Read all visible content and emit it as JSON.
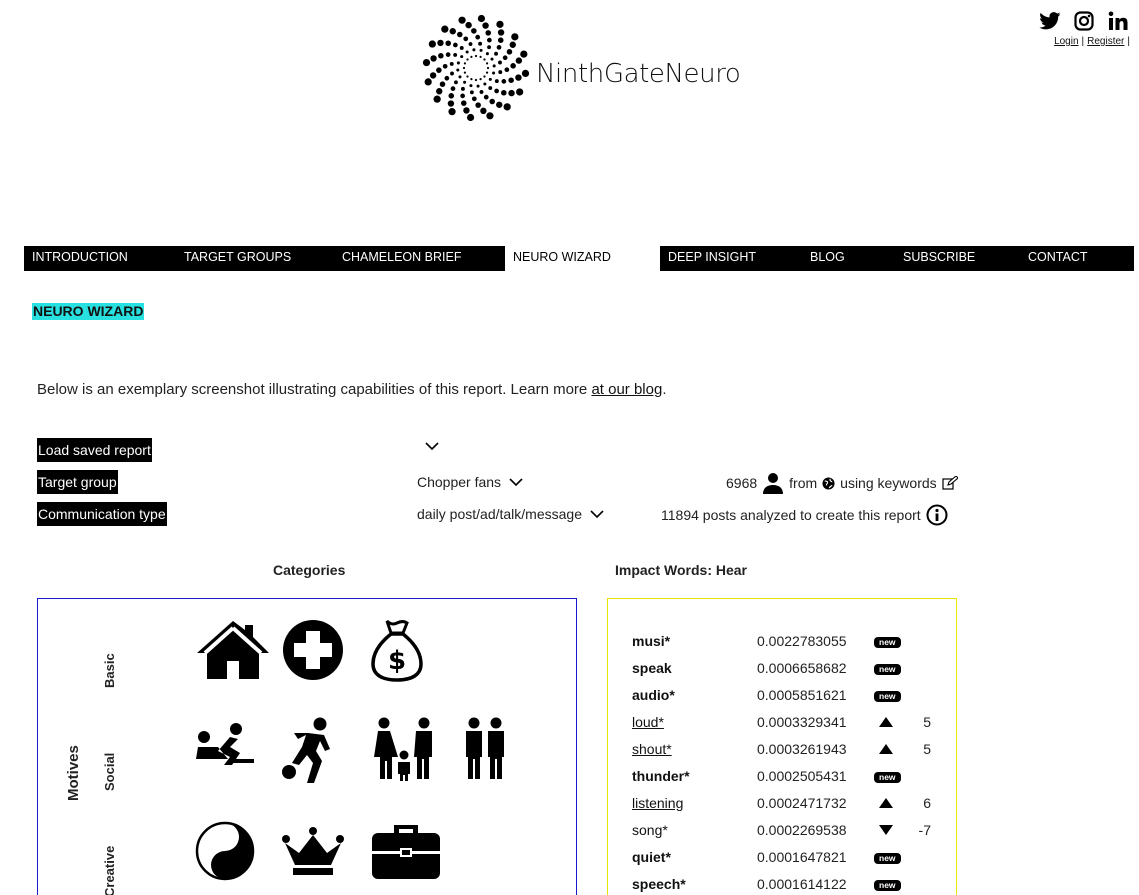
{
  "brand": {
    "name": "NinthGateNeuro",
    "logo_icon": "spiral-dots-logo"
  },
  "social": {
    "icons": [
      "twitter-icon",
      "instagram-icon",
      "linkedin-icon"
    ]
  },
  "auth": {
    "login": "Login",
    "sep": "|",
    "register": "Register"
  },
  "nav": {
    "items": [
      {
        "label": "INTRODUCTION"
      },
      {
        "label": "TARGET GROUPS"
      },
      {
        "label": "CHAMELEON BRIEF"
      },
      {
        "label": "NEURO WIZARD",
        "active": true
      },
      {
        "label": "DEEP INSIGHT"
      },
      {
        "label": "BLOG"
      },
      {
        "label": "SUBSCRIBE"
      },
      {
        "label": "CONTACT"
      }
    ]
  },
  "page": {
    "heading": "NEURO WIZARD",
    "intro_text": "Below is an exemplary screenshot illustrating capabilities of this report. Learn more ",
    "intro_link": "at our blog",
    "intro_end": "."
  },
  "controls": {
    "load_label": "Load saved report",
    "load_value": "",
    "target_label": "Target group",
    "target_value": "Chopper fans",
    "target_count": "6968",
    "target_from": "from",
    "target_using": "using keywords",
    "comm_label": "Communication type",
    "comm_value": "daily post/ad/talk/message",
    "comm_info": "11894 posts analyzed to create this report"
  },
  "categories": {
    "title": "Categories",
    "group": "Motives",
    "rows": [
      {
        "label": "Basic",
        "icons": [
          "home-icon",
          "health-cross-icon",
          "money-bag-icon"
        ]
      },
      {
        "label": "Social",
        "icons": [
          "intimacy-icon",
          "soccer-player-icon",
          "family-icon",
          "couple-icon"
        ]
      },
      {
        "label": "Creative",
        "icons": [
          "yin-yang-icon",
          "crown-icon",
          "briefcase-icon"
        ]
      }
    ]
  },
  "impact": {
    "title": "Impact Words: Hear",
    "badge_text": "new",
    "rows": [
      {
        "word": "musi*",
        "value": "0.0022783055",
        "status": "new",
        "bold": true,
        "link": false,
        "delta": ""
      },
      {
        "word": "speak",
        "value": "0.0006658682",
        "status": "new",
        "bold": true,
        "link": false,
        "delta": ""
      },
      {
        "word": "audio*",
        "value": "0.0005851621",
        "status": "new",
        "bold": true,
        "link": false,
        "delta": ""
      },
      {
        "word": "loud*",
        "value": "0.0003329341",
        "status": "up",
        "bold": false,
        "link": true,
        "delta": "5"
      },
      {
        "word": "shout*",
        "value": "0.0003261943",
        "status": "up",
        "bold": false,
        "link": true,
        "delta": "5"
      },
      {
        "word": "thunder*",
        "value": "0.0002505431",
        "status": "new",
        "bold": true,
        "link": false,
        "delta": ""
      },
      {
        "word": "listening",
        "value": "0.0002471732",
        "status": "up",
        "bold": false,
        "link": true,
        "delta": "6"
      },
      {
        "word": "song*",
        "value": "0.0002269538",
        "status": "down",
        "bold": false,
        "link": false,
        "delta": "-7"
      },
      {
        "word": "quiet*",
        "value": "0.0001647821",
        "status": "new",
        "bold": true,
        "link": false,
        "delta": ""
      },
      {
        "word": "speech*",
        "value": "0.0001614122",
        "status": "new",
        "bold": true,
        "link": false,
        "delta": ""
      }
    ]
  }
}
